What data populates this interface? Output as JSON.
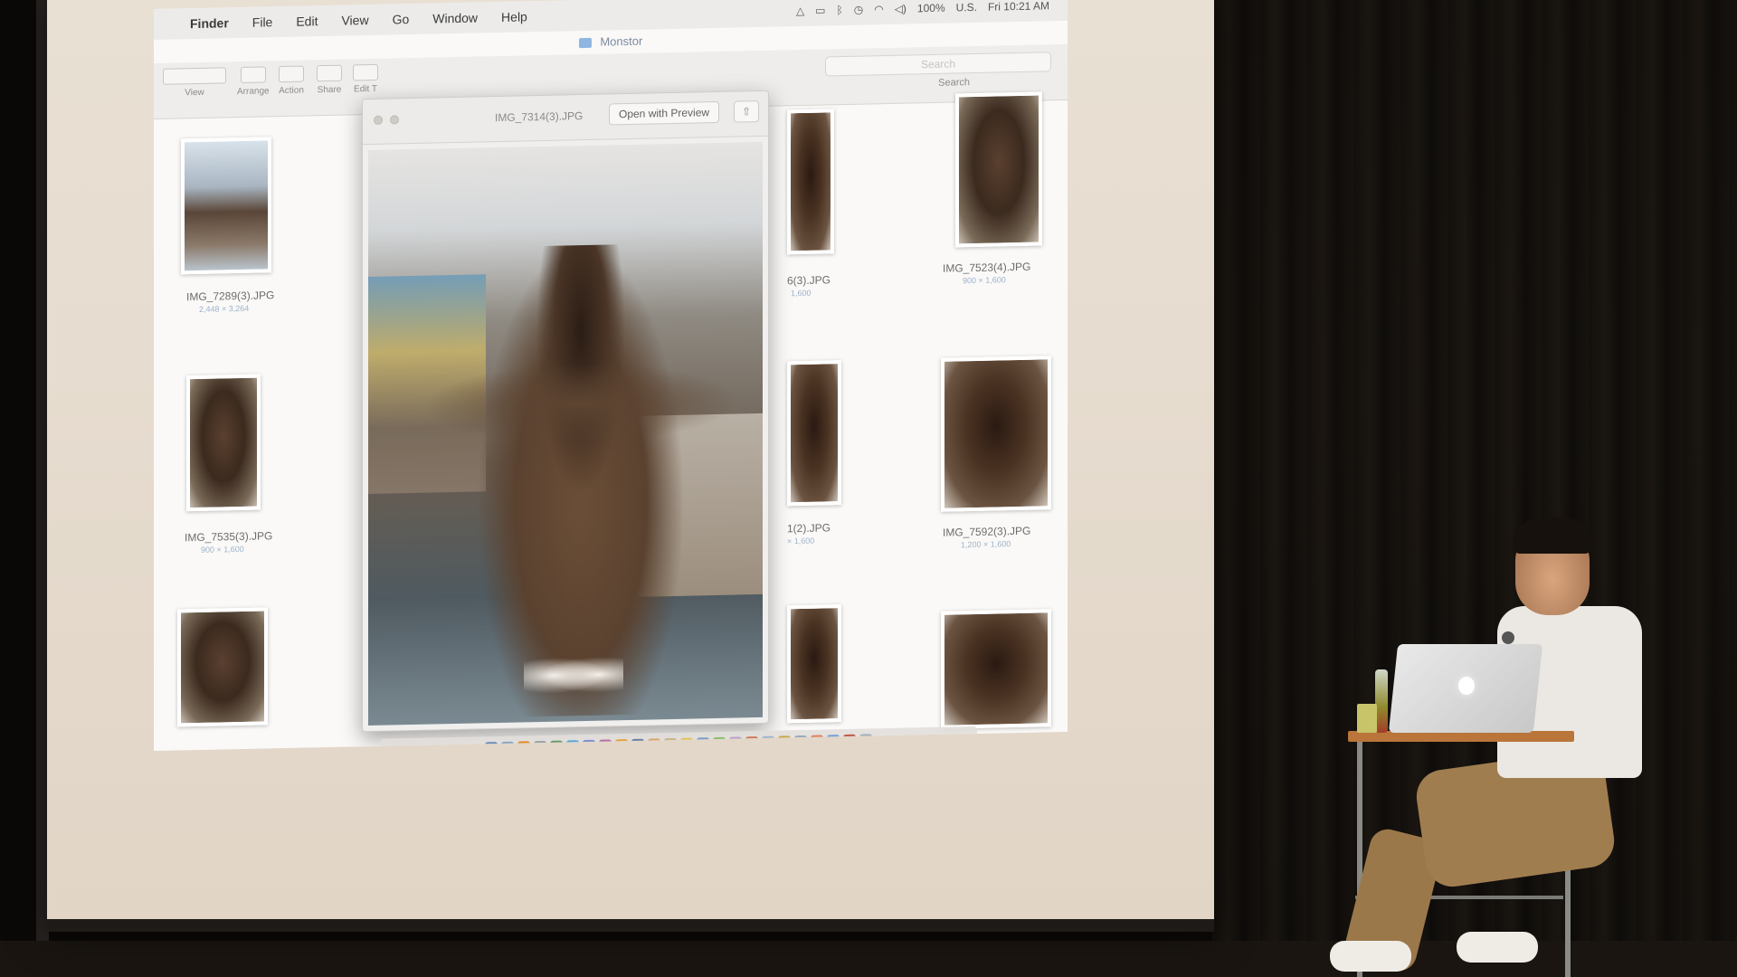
{
  "menubar": {
    "apple_symbol": "",
    "items": [
      "Finder",
      "File",
      "Edit",
      "View",
      "Go",
      "Window",
      "Help"
    ],
    "battery": "100%",
    "input_source": "U.S.",
    "clock": "Fri 10:21 AM"
  },
  "finder": {
    "window_title": "Monstor",
    "toolbar": {
      "view_label": "View",
      "arrange_label": "Arrange",
      "action_label": "Action",
      "share_label": "Share",
      "edit_label": "Edit T"
    },
    "search": {
      "placeholder": "Search",
      "label": "Search"
    },
    "files": [
      {
        "name": "IMG_7289(3).JPG",
        "dims": "2,448 × 3,264"
      },
      {
        "name": "IMG_7535(3).JPG",
        "dims": "900 × 1,600"
      },
      {
        "name": "6(3).JPG",
        "dims": "1,600"
      },
      {
        "name": "1(2).JPG",
        "dims": "× 1,600"
      },
      {
        "name": "IMG_7523(4).JPG",
        "dims": "900 × 1,600"
      },
      {
        "name": "IMG_7592(3).JPG",
        "dims": "1,200 × 1,600"
      }
    ]
  },
  "quicklook": {
    "title": "IMG_7314(3).JPG",
    "open_button": "Open with Preview"
  },
  "colors": {
    "projection_bg": "#e6dccf",
    "accent_blue": "#9db2cc",
    "monster_fur": "#5a4230"
  }
}
